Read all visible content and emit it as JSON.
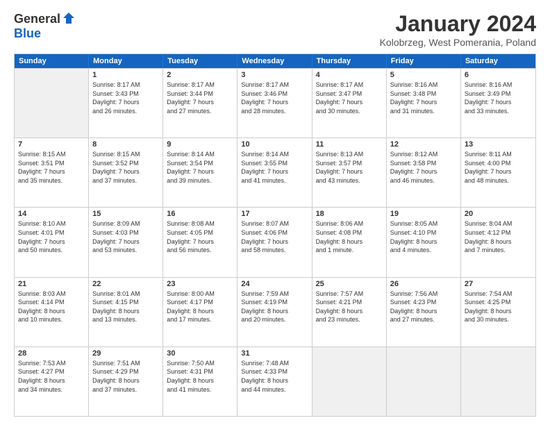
{
  "logo": {
    "general": "General",
    "blue": "Blue"
  },
  "title": "January 2024",
  "location": "Kolobrzeg, West Pomerania, Poland",
  "days": [
    "Sunday",
    "Monday",
    "Tuesday",
    "Wednesday",
    "Thursday",
    "Friday",
    "Saturday"
  ],
  "rows": [
    [
      {
        "day": "",
        "lines": []
      },
      {
        "day": "1",
        "lines": [
          "Sunrise: 8:17 AM",
          "Sunset: 3:43 PM",
          "Daylight: 7 hours",
          "and 26 minutes."
        ]
      },
      {
        "day": "2",
        "lines": [
          "Sunrise: 8:17 AM",
          "Sunset: 3:44 PM",
          "Daylight: 7 hours",
          "and 27 minutes."
        ]
      },
      {
        "day": "3",
        "lines": [
          "Sunrise: 8:17 AM",
          "Sunset: 3:46 PM",
          "Daylight: 7 hours",
          "and 28 minutes."
        ]
      },
      {
        "day": "4",
        "lines": [
          "Sunrise: 8:17 AM",
          "Sunset: 3:47 PM",
          "Daylight: 7 hours",
          "and 30 minutes."
        ]
      },
      {
        "day": "5",
        "lines": [
          "Sunrise: 8:16 AM",
          "Sunset: 3:48 PM",
          "Daylight: 7 hours",
          "and 31 minutes."
        ]
      },
      {
        "day": "6",
        "lines": [
          "Sunrise: 8:16 AM",
          "Sunset: 3:49 PM",
          "Daylight: 7 hours",
          "and 33 minutes."
        ]
      }
    ],
    [
      {
        "day": "7",
        "lines": [
          "Sunrise: 8:15 AM",
          "Sunset: 3:51 PM",
          "Daylight: 7 hours",
          "and 35 minutes."
        ]
      },
      {
        "day": "8",
        "lines": [
          "Sunrise: 8:15 AM",
          "Sunset: 3:52 PM",
          "Daylight: 7 hours",
          "and 37 minutes."
        ]
      },
      {
        "day": "9",
        "lines": [
          "Sunrise: 8:14 AM",
          "Sunset: 3:54 PM",
          "Daylight: 7 hours",
          "and 39 minutes."
        ]
      },
      {
        "day": "10",
        "lines": [
          "Sunrise: 8:14 AM",
          "Sunset: 3:55 PM",
          "Daylight: 7 hours",
          "and 41 minutes."
        ]
      },
      {
        "day": "11",
        "lines": [
          "Sunrise: 8:13 AM",
          "Sunset: 3:57 PM",
          "Daylight: 7 hours",
          "and 43 minutes."
        ]
      },
      {
        "day": "12",
        "lines": [
          "Sunrise: 8:12 AM",
          "Sunset: 3:58 PM",
          "Daylight: 7 hours",
          "and 46 minutes."
        ]
      },
      {
        "day": "13",
        "lines": [
          "Sunrise: 8:11 AM",
          "Sunset: 4:00 PM",
          "Daylight: 7 hours",
          "and 48 minutes."
        ]
      }
    ],
    [
      {
        "day": "14",
        "lines": [
          "Sunrise: 8:10 AM",
          "Sunset: 4:01 PM",
          "Daylight: 7 hours",
          "and 50 minutes."
        ]
      },
      {
        "day": "15",
        "lines": [
          "Sunrise: 8:09 AM",
          "Sunset: 4:03 PM",
          "Daylight: 7 hours",
          "and 53 minutes."
        ]
      },
      {
        "day": "16",
        "lines": [
          "Sunrise: 8:08 AM",
          "Sunset: 4:05 PM",
          "Daylight: 7 hours",
          "and 56 minutes."
        ]
      },
      {
        "day": "17",
        "lines": [
          "Sunrise: 8:07 AM",
          "Sunset: 4:06 PM",
          "Daylight: 7 hours",
          "and 58 minutes."
        ]
      },
      {
        "day": "18",
        "lines": [
          "Sunrise: 8:06 AM",
          "Sunset: 4:08 PM",
          "Daylight: 8 hours",
          "and 1 minute."
        ]
      },
      {
        "day": "19",
        "lines": [
          "Sunrise: 8:05 AM",
          "Sunset: 4:10 PM",
          "Daylight: 8 hours",
          "and 4 minutes."
        ]
      },
      {
        "day": "20",
        "lines": [
          "Sunrise: 8:04 AM",
          "Sunset: 4:12 PM",
          "Daylight: 8 hours",
          "and 7 minutes."
        ]
      }
    ],
    [
      {
        "day": "21",
        "lines": [
          "Sunrise: 8:03 AM",
          "Sunset: 4:14 PM",
          "Daylight: 8 hours",
          "and 10 minutes."
        ]
      },
      {
        "day": "22",
        "lines": [
          "Sunrise: 8:01 AM",
          "Sunset: 4:15 PM",
          "Daylight: 8 hours",
          "and 13 minutes."
        ]
      },
      {
        "day": "23",
        "lines": [
          "Sunrise: 8:00 AM",
          "Sunset: 4:17 PM",
          "Daylight: 8 hours",
          "and 17 minutes."
        ]
      },
      {
        "day": "24",
        "lines": [
          "Sunrise: 7:59 AM",
          "Sunset: 4:19 PM",
          "Daylight: 8 hours",
          "and 20 minutes."
        ]
      },
      {
        "day": "25",
        "lines": [
          "Sunrise: 7:57 AM",
          "Sunset: 4:21 PM",
          "Daylight: 8 hours",
          "and 23 minutes."
        ]
      },
      {
        "day": "26",
        "lines": [
          "Sunrise: 7:56 AM",
          "Sunset: 4:23 PM",
          "Daylight: 8 hours",
          "and 27 minutes."
        ]
      },
      {
        "day": "27",
        "lines": [
          "Sunrise: 7:54 AM",
          "Sunset: 4:25 PM",
          "Daylight: 8 hours",
          "and 30 minutes."
        ]
      }
    ],
    [
      {
        "day": "28",
        "lines": [
          "Sunrise: 7:53 AM",
          "Sunset: 4:27 PM",
          "Daylight: 8 hours",
          "and 34 minutes."
        ]
      },
      {
        "day": "29",
        "lines": [
          "Sunrise: 7:51 AM",
          "Sunset: 4:29 PM",
          "Daylight: 8 hours",
          "and 37 minutes."
        ]
      },
      {
        "day": "30",
        "lines": [
          "Sunrise: 7:50 AM",
          "Sunset: 4:31 PM",
          "Daylight: 8 hours",
          "and 41 minutes."
        ]
      },
      {
        "day": "31",
        "lines": [
          "Sunrise: 7:48 AM",
          "Sunset: 4:33 PM",
          "Daylight: 8 hours",
          "and 44 minutes."
        ]
      },
      {
        "day": "",
        "lines": []
      },
      {
        "day": "",
        "lines": []
      },
      {
        "day": "",
        "lines": []
      }
    ]
  ]
}
